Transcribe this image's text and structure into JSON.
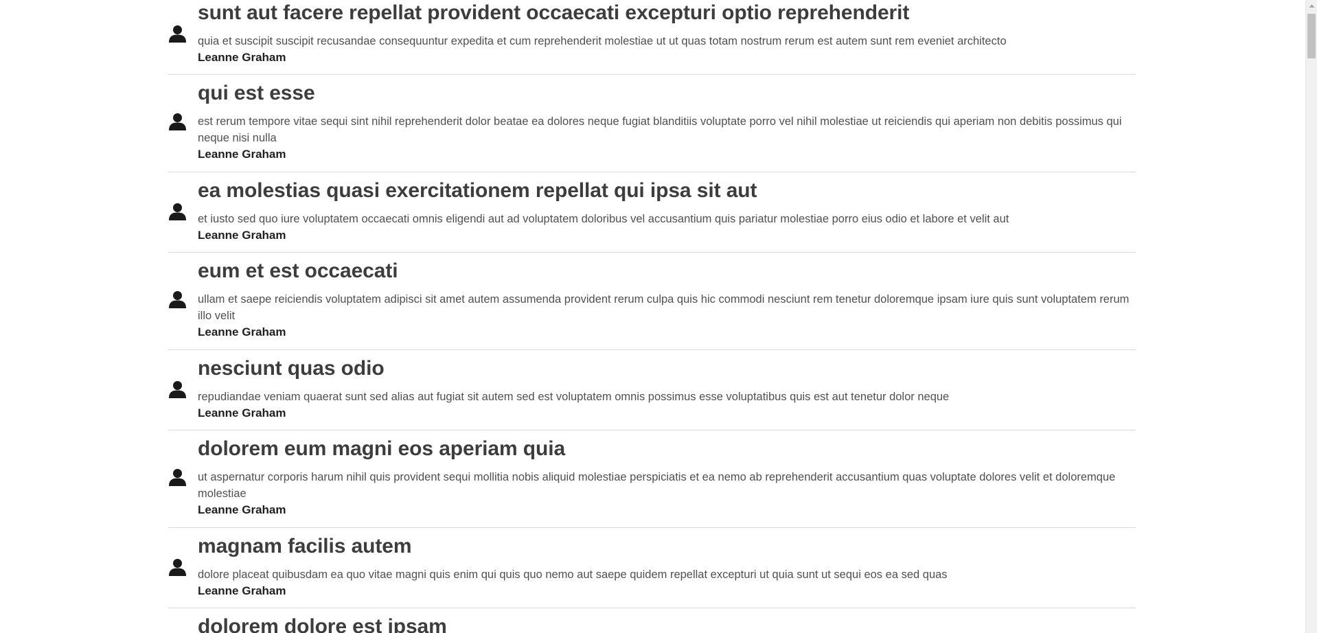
{
  "posts": [
    {
      "title": "sunt aut facere repellat provident occaecati excepturi optio reprehenderit",
      "body": "quia et suscipit suscipit recusandae consequuntur expedita et cum reprehenderit molestiae ut ut quas totam nostrum rerum est autem sunt rem eveniet architecto",
      "author": "Leanne Graham",
      "icon": "user-icon"
    },
    {
      "title": "qui est esse",
      "body": "est rerum tempore vitae sequi sint nihil reprehenderit dolor beatae ea dolores neque fugiat blanditiis voluptate porro vel nihil molestiae ut reiciendis qui aperiam non debitis possimus qui neque nisi nulla",
      "author": "Leanne Graham",
      "icon": "user-icon"
    },
    {
      "title": "ea molestias quasi exercitationem repellat qui ipsa sit aut",
      "body": "et iusto sed quo iure voluptatem occaecati omnis eligendi aut ad voluptatem doloribus vel accusantium quis pariatur molestiae porro eius odio et labore et velit aut",
      "author": "Leanne Graham",
      "icon": "user-icon"
    },
    {
      "title": "eum et est occaecati",
      "body": "ullam et saepe reiciendis voluptatem adipisci sit amet autem assumenda provident rerum culpa quis hic commodi nesciunt rem tenetur doloremque ipsam iure quis sunt voluptatem rerum illo velit",
      "author": "Leanne Graham",
      "icon": "user-icon"
    },
    {
      "title": "nesciunt quas odio",
      "body": "repudiandae veniam quaerat sunt sed alias aut fugiat sit autem sed est voluptatem omnis possimus esse voluptatibus quis est aut tenetur dolor neque",
      "author": "Leanne Graham",
      "icon": "user-icon"
    },
    {
      "title": "dolorem eum magni eos aperiam quia",
      "body": "ut aspernatur corporis harum nihil quis provident sequi mollitia nobis aliquid molestiae perspiciatis et ea nemo ab reprehenderit accusantium quas voluptate dolores velit et doloremque molestiae",
      "author": "Leanne Graham",
      "icon": "user-icon"
    },
    {
      "title": "magnam facilis autem",
      "body": "dolore placeat quibusdam ea quo vitae magni quis enim qui quis quo nemo aut saepe quidem repellat excepturi ut quia sunt ut sequi eos ea sed quas",
      "author": "Leanne Graham",
      "icon": "user-icon"
    },
    {
      "title": "dolorem dolore est ipsam",
      "body": "",
      "author": "",
      "icon": "user-icon"
    }
  ],
  "scrollbar": {
    "position": 0.0
  },
  "colors": {
    "title": "#3d3d3d",
    "body": "#505050",
    "author": "#1f1f1f",
    "divider": "#d9d9d9",
    "icon": "#1a1a1a"
  }
}
